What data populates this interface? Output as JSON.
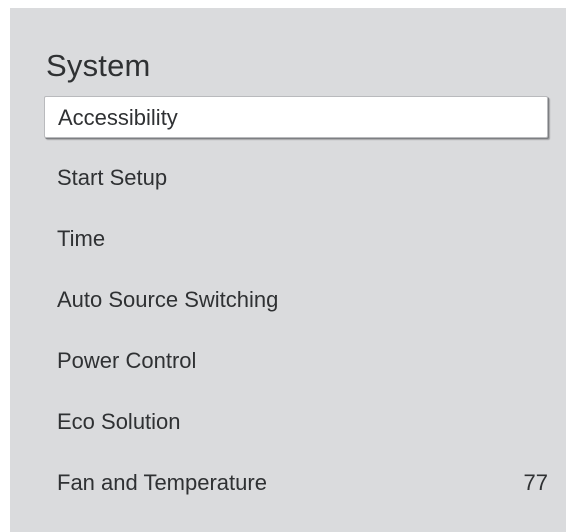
{
  "menu": {
    "title": "System",
    "items": [
      {
        "label": "Accessibility",
        "selected": true
      },
      {
        "label": "Start Setup",
        "selected": false
      },
      {
        "label": "Time",
        "selected": false
      },
      {
        "label": "Auto Source Switching",
        "selected": false
      },
      {
        "label": "Power Control",
        "selected": false
      },
      {
        "label": "Eco Solution",
        "selected": false
      },
      {
        "label": "Fan and Temperature",
        "selected": false
      }
    ]
  },
  "page_number": "77",
  "colors": {
    "panel_background": "#dadbdd",
    "selected_background": "#ffffff",
    "text": "#2f3133"
  }
}
